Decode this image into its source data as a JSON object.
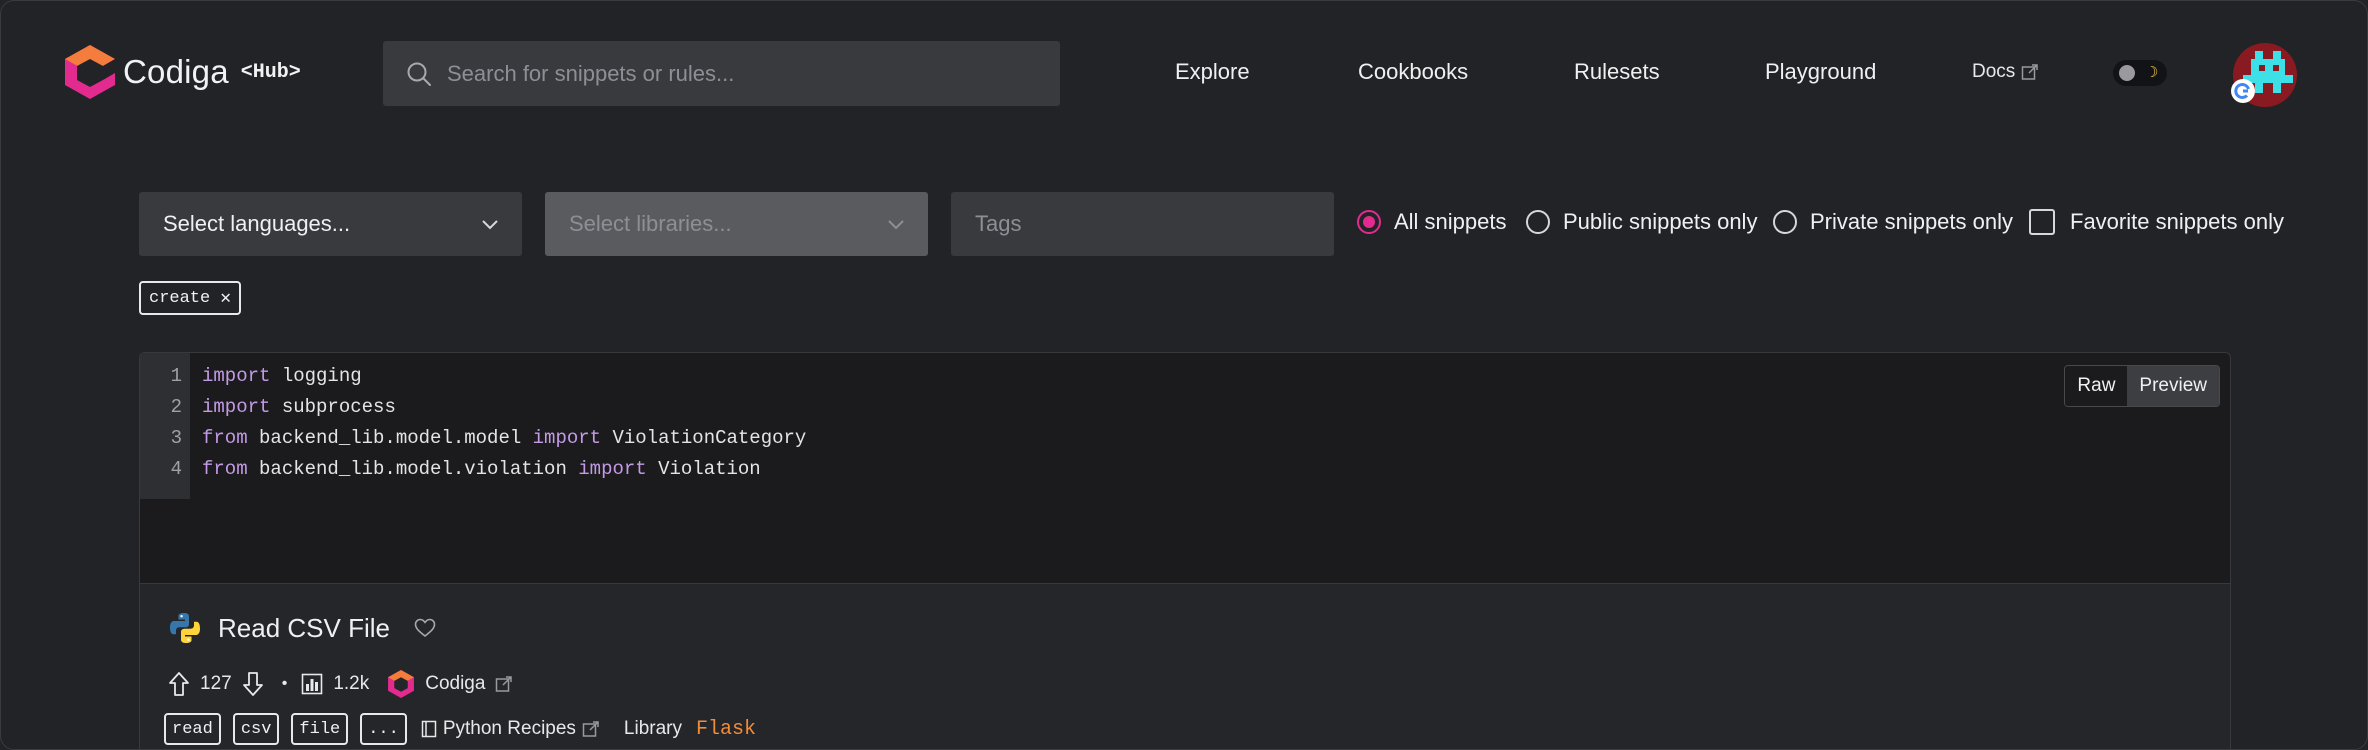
{
  "header": {
    "brand": "Codiga",
    "brand_sub": "<Hub>",
    "search_placeholder": "Search for snippets or rules...",
    "nav": [
      "Explore",
      "Cookbooks",
      "Rulesets",
      "Playground"
    ],
    "docs_label": "Docs"
  },
  "filters": {
    "languages_placeholder": "Select languages...",
    "libraries_placeholder": "Select libraries...",
    "tags_placeholder": "Tags",
    "radios": [
      "All snippets",
      "Public snippets only",
      "Private snippets only"
    ],
    "selected_radio": "All snippets",
    "favorite_label": "Favorite snippets only",
    "active_tag": "create"
  },
  "snippet": {
    "code_lines": [
      {
        "num": "1",
        "kw1": "import",
        "rest1": " logging",
        "kw2": "",
        "rest2": ""
      },
      {
        "num": "2",
        "kw1": "import",
        "rest1": " subprocess",
        "kw2": "",
        "rest2": ""
      },
      {
        "num": "3",
        "kw1": "from",
        "rest1": " backend_lib.model.model ",
        "kw2": "import",
        "rest2": " ViolationCategory"
      },
      {
        "num": "4",
        "kw1": "from",
        "rest1": " backend_lib.model.violation ",
        "kw2": "import",
        "rest2": " Violation"
      }
    ],
    "view_raw": "Raw",
    "view_preview": "Preview",
    "title": "Read CSV File",
    "upvotes": "127",
    "views": "1.2k",
    "owner": "Codiga",
    "tags": [
      "read",
      "csv",
      "file",
      "..."
    ],
    "cookbook": "Python Recipes",
    "library_label": "Library",
    "library": "Flask"
  },
  "colors": {
    "accent": "#e32a8f",
    "keyword": "#c39ae6",
    "library": "#f28c38"
  }
}
